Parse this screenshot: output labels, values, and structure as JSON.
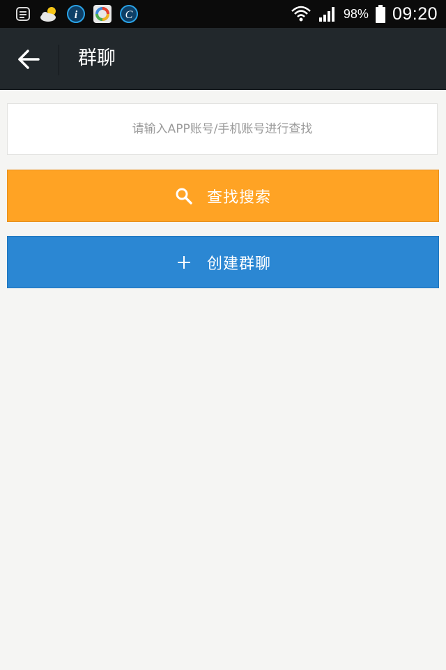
{
  "status_bar": {
    "icons": [
      "notes-icon",
      "weather-icon",
      "info-icon",
      "app-icon",
      "c-icon",
      "wifi-icon",
      "signal-icon",
      "battery-icon"
    ],
    "battery_percent": "98%",
    "time": "09:20"
  },
  "app_bar": {
    "back_icon": "arrow-left-icon",
    "title": "群聊"
  },
  "search": {
    "placeholder": "请输入APP账号/手机账号进行查找",
    "value": ""
  },
  "buttons": {
    "search_label": "查找搜索",
    "search_icon": "search-icon",
    "create_label": "创建群聊",
    "create_icon": "plus-icon"
  },
  "colors": {
    "status_bar_bg": "#0b0b0b",
    "app_bar_bg": "#22282c",
    "page_bg": "#f5f5f3",
    "search_button": "#ffa324",
    "create_button": "#2b87d3"
  }
}
